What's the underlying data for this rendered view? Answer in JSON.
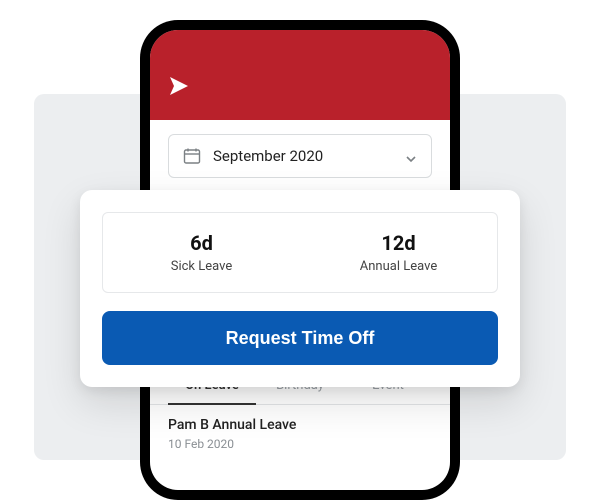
{
  "colors": {
    "header": "#b9212b",
    "primary_button": "#0a5ab3",
    "bg_panel": "#eceef0"
  },
  "header": {
    "logo_name": "app-logo"
  },
  "date_picker": {
    "label": "September 2020"
  },
  "balances": [
    {
      "value": "6d",
      "label": "Sick Leave"
    },
    {
      "value": "12d",
      "label": "Annual Leave"
    }
  ],
  "request_button": {
    "label": "Request Time Off"
  },
  "tabs": [
    {
      "label": "On Leave",
      "active": true
    },
    {
      "label": "Birthday",
      "active": false
    },
    {
      "label": "Event",
      "active": false
    }
  ],
  "leave_list": [
    {
      "title": "Pam B Annual Leave",
      "date": "10 Feb 2020"
    }
  ]
}
